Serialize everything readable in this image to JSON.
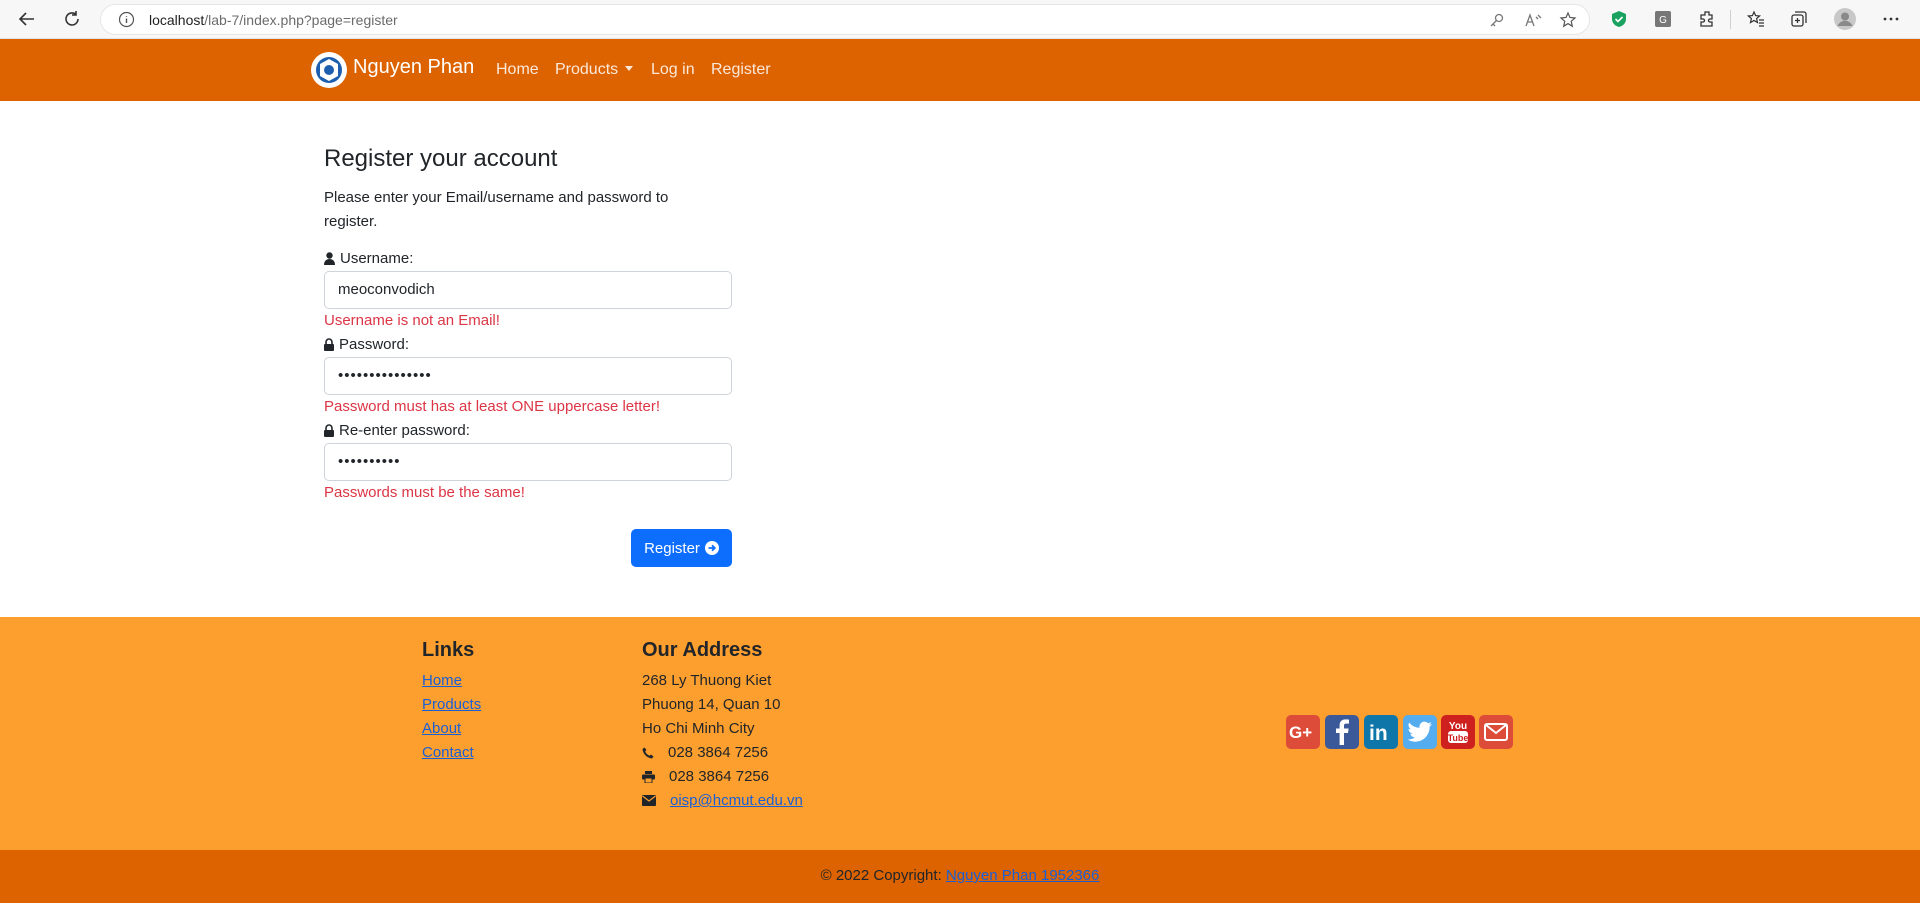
{
  "browser": {
    "url_host": "localhost",
    "url_path": "/lab-7/index.php?page=register"
  },
  "navbar": {
    "brand": "Nguyen Phan",
    "links": [
      "Home",
      "Products",
      "Log in",
      "Register"
    ]
  },
  "form": {
    "title": "Register your account",
    "description": "Please enter your Email/username and password to register.",
    "username_label": "Username:",
    "username_value": "meoconvodich",
    "username_error": "Username is not an Email!",
    "password_label": "Password:",
    "password_value": "•••••••••••••••",
    "password_error": "Password must has at least ONE uppercase letter!",
    "repassword_label": "Re-enter password:",
    "repassword_value": "••••••••••",
    "repassword_error": "Passwords must be the same!",
    "submit_label": "Register"
  },
  "footer": {
    "links_title": "Links",
    "links": [
      "Home",
      "Products",
      "About",
      "Contact"
    ],
    "address_title": "Our Address",
    "address_lines": [
      "268 Ly Thuong Kiet",
      "Phuong 14, Quan 10",
      "Ho Chi Minh City"
    ],
    "phone": "028 3864 7256",
    "fax": "028 3864 7256",
    "email": "oisp@hcmut.edu.vn",
    "social": [
      {
        "icon": "google-plus-icon",
        "color": "#dd4b39"
      },
      {
        "icon": "facebook-icon",
        "color": "#3b5998"
      },
      {
        "icon": "linkedin-icon",
        "color": "#0e76a8"
      },
      {
        "icon": "twitter-icon",
        "color": "#55acee"
      },
      {
        "icon": "youtube-icon",
        "color": "#cd201f"
      },
      {
        "icon": "mail-icon",
        "color": "#dd4b39"
      }
    ],
    "copyright_prefix": "© 2022 Copyright:",
    "copyright_link": "Nguyen Phan 1952366"
  },
  "colors": {
    "navbar": "#dd6300",
    "footer": "#fd9f2e",
    "error": "#dc3545",
    "primary": "#0d6efd"
  }
}
